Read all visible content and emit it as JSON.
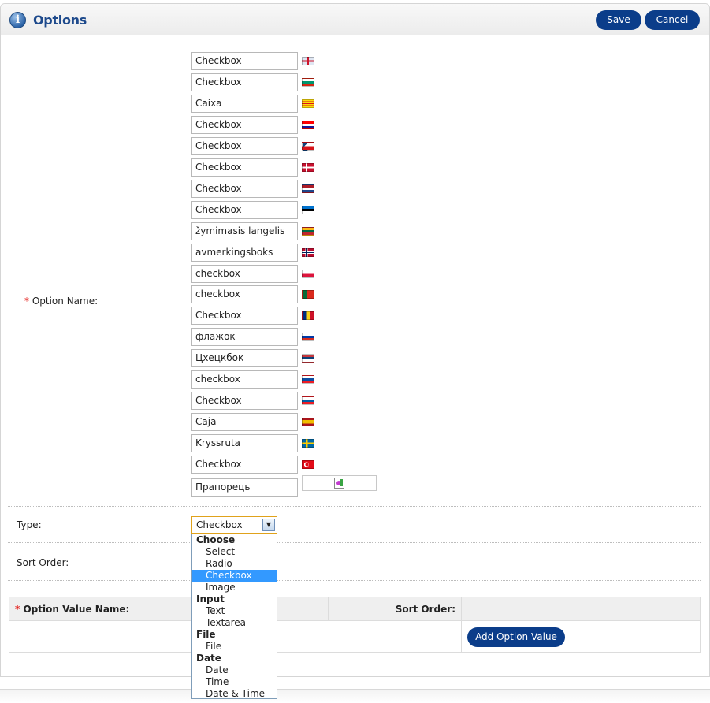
{
  "header": {
    "title": "Options",
    "save_label": "Save",
    "cancel_label": "Cancel",
    "info_icon": "info-icon"
  },
  "form": {
    "option_name": {
      "required_mark": "*",
      "label": "Option Name:",
      "entries": [
        {
          "value": "Checkbox",
          "flag": "flag-uk"
        },
        {
          "value": "Checkbox",
          "flag": "flag-bulgaria"
        },
        {
          "value": "Caixa",
          "flag": "flag-catalonia"
        },
        {
          "value": "Checkbox",
          "flag": "flag-croatia"
        },
        {
          "value": "Checkbox",
          "flag": "flag-czech"
        },
        {
          "value": "Checkbox",
          "flag": "flag-denmark"
        },
        {
          "value": "Checkbox",
          "flag": "flag-netherlands"
        },
        {
          "value": "Checkbox",
          "flag": "flag-estonia"
        },
        {
          "value": "žymimasis langelis",
          "flag": "flag-lithuania"
        },
        {
          "value": "avmerkingsboks",
          "flag": "flag-norway"
        },
        {
          "value": "checkbox",
          "flag": "flag-poland"
        },
        {
          "value": "checkbox",
          "flag": "flag-portugal"
        },
        {
          "value": "Checkbox",
          "flag": "flag-romania"
        },
        {
          "value": "флажок",
          "flag": "flag-russia"
        },
        {
          "value": "Цхецкбок",
          "flag": "flag-serbia"
        },
        {
          "value": "checkbox",
          "flag": "flag-slovakia"
        },
        {
          "value": "Checkbox",
          "flag": "flag-slovenia"
        },
        {
          "value": "Caja",
          "flag": "flag-spain"
        },
        {
          "value": "Kryssruta",
          "flag": "flag-sweden"
        },
        {
          "value": "Checkbox",
          "flag": "flag-turkey"
        },
        {
          "value": "Прапорець",
          "flag": "broken-image-icon"
        }
      ]
    },
    "type": {
      "label": "Type:",
      "selected": "Checkbox",
      "dropdown": [
        {
          "kind": "group",
          "label": "Choose"
        },
        {
          "kind": "option",
          "label": "Select"
        },
        {
          "kind": "option",
          "label": "Radio"
        },
        {
          "kind": "option",
          "label": "Checkbox",
          "selected": true
        },
        {
          "kind": "option",
          "label": "Image"
        },
        {
          "kind": "group",
          "label": "Input"
        },
        {
          "kind": "option",
          "label": "Text"
        },
        {
          "kind": "option",
          "label": "Textarea"
        },
        {
          "kind": "group",
          "label": "File"
        },
        {
          "kind": "option",
          "label": "File"
        },
        {
          "kind": "group",
          "label": "Date"
        },
        {
          "kind": "option",
          "label": "Date"
        },
        {
          "kind": "option",
          "label": "Time"
        },
        {
          "kind": "option",
          "label": "Date & Time"
        }
      ]
    },
    "sort_order": {
      "label": "Sort Order:"
    }
  },
  "values_table": {
    "required_mark": "*",
    "col_name": "Option Value Name:",
    "col_sort": "Sort Order:",
    "add_button": "Add Option Value"
  },
  "colors": {
    "accent": "#0b3d8a",
    "title": "#1e4a8c",
    "required": "#e41b17",
    "selected_option": "#3399ff"
  }
}
